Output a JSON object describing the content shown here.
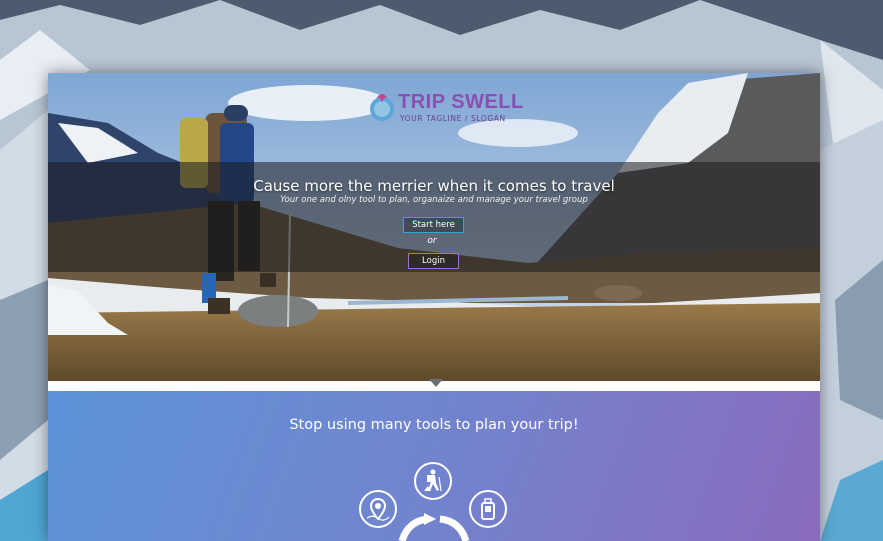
{
  "brand": {
    "name": "TRIP SWELL",
    "tagline": "YOUR TAGLINE / SLOGAN"
  },
  "hero": {
    "title": "Cause more the merrier when it comes to travel",
    "subtitle": "Your one and olny tool to plan, organaize and manage your travel group",
    "start_label": "Start here",
    "or_label": "or",
    "login_label": "Login"
  },
  "features": {
    "title": "Stop using many tools to plan your trip!",
    "icons": [
      "hiker-icon",
      "location-pin-icon",
      "luggage-icon",
      "cycle-arrows-icon"
    ]
  },
  "colors": {
    "brand_purple": "#8a4fb3",
    "start_border": "#2fa8d6",
    "login_border": "#9a6fd6",
    "gradient_start": "#5d93d8",
    "gradient_end": "#8a6bbf"
  }
}
